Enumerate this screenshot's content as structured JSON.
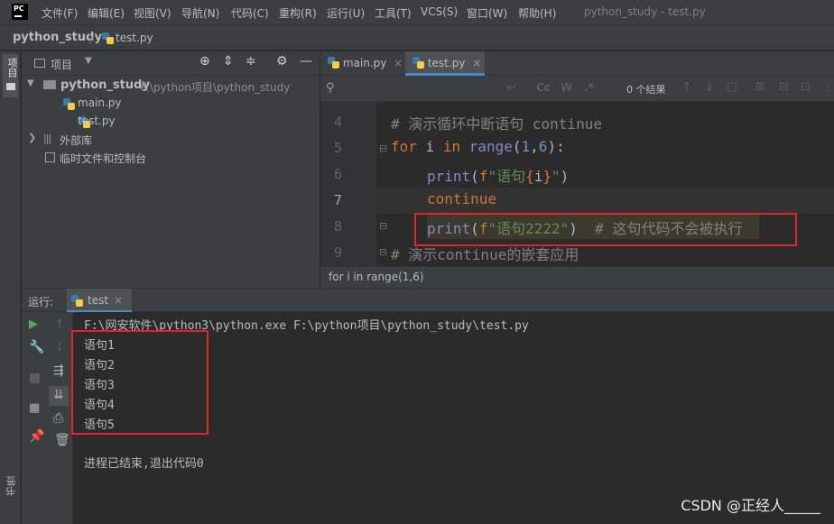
{
  "app": {
    "logo_text": "PC",
    "window_title": "python_study - test.py"
  },
  "menu": [
    "文件(F)",
    "编辑(E)",
    "视图(V)",
    "导航(N)",
    "代码(C)",
    "重构(R)",
    "运行(U)",
    "工具(T)",
    "VCS(S)",
    "窗口(W)",
    "帮助(H)"
  ],
  "breadcrumb": {
    "project": "python_study",
    "file": "test.py"
  },
  "left_strip": {
    "project_label": "项目",
    "bookmarks_label": "书签"
  },
  "project_panel": {
    "title": "项目",
    "root_name": "python_study",
    "root_path": "F:\\python项目\\python_study",
    "files": [
      "main.py",
      "test.py"
    ],
    "external_libs": "外部库",
    "scratches": "临时文件和控制台"
  },
  "editor": {
    "tabs": [
      {
        "label": "main.py",
        "active": false
      },
      {
        "label": "test.py",
        "active": true
      }
    ],
    "find": {
      "results": "0 个结果",
      "case_label": "Cc",
      "word_label": "W",
      "regex_label": ".*"
    },
    "line_numbers": [
      "4",
      "5",
      "6",
      "7",
      "8",
      "9"
    ],
    "lines": {
      "l4_comment": "# 演示循环中断语句 continue",
      "l5_for": "for",
      "l5_i": " i ",
      "l5_in": "in",
      "l5_range": " range",
      "l5_open": "(",
      "l5_n1": "1",
      "l5_comma": ",",
      "l5_n2": "6",
      "l5_close": "):",
      "l6_print": "print",
      "l6_open": "(",
      "l6_f": "f",
      "l6_str1": "\"语句",
      "l6_brace_open": "{",
      "l6_var": "i",
      "l6_brace_close": "}",
      "l6_str2": "\"",
      "l6_close": ")",
      "l7_continue": "continue",
      "l8_print": "print",
      "l8_open": "(",
      "l8_f": "f",
      "l8_str": "\"语句2222\"",
      "l8_close": ")",
      "l8_comment": "  # 这句代码不会被执行",
      "l9_comment": "# 演示continue的嵌套应用"
    },
    "status": "for i in range(1,6)"
  },
  "run_panel": {
    "label": "运行:",
    "tab": "test",
    "command": "F:\\网安软件\\python3\\python.exe F:\\python项目\\python_study\\test.py",
    "output": [
      "语句1",
      "语句2",
      "语句3",
      "语句4",
      "语句5"
    ],
    "exit_message": "进程已结束,退出代码0"
  },
  "watermark": "CSDN @正经人_____",
  "colors": {
    "background": "#2b2b2b",
    "panel": "#3c3f41",
    "keyword": "#cc7832",
    "builtin": "#8888c6",
    "string": "#6a8759",
    "number": "#6897bb",
    "comment": "#808080",
    "annotation_box": "#e0242b"
  }
}
